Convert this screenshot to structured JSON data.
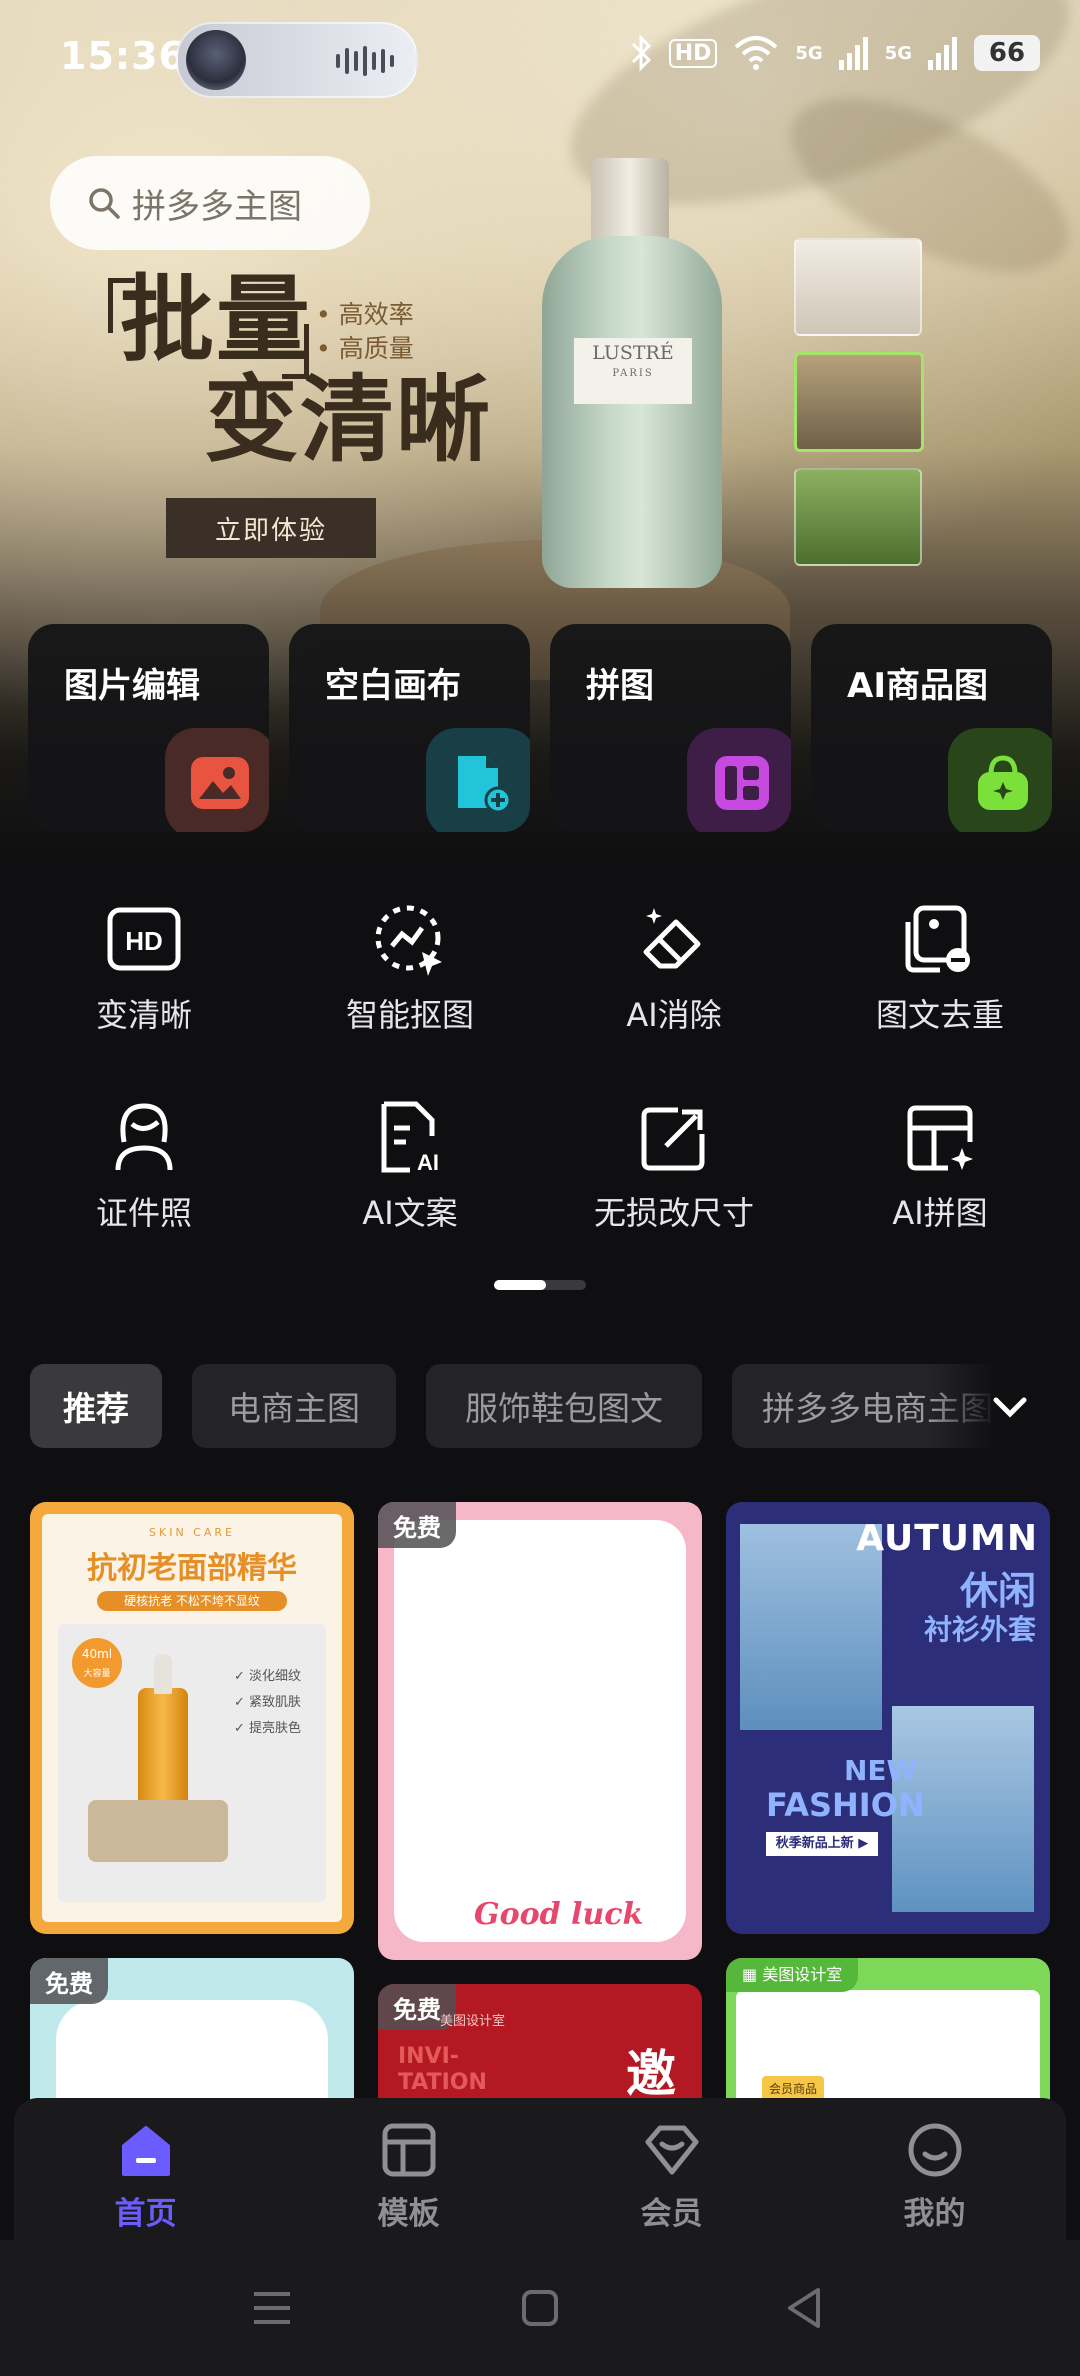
{
  "status_bar": {
    "time": "15:36",
    "hd": "HD",
    "signal1": "5G",
    "signal2": "5G",
    "battery": "66"
  },
  "search": {
    "placeholder": "拼多多主图"
  },
  "banner": {
    "title_line1": "批量",
    "title_line2": "变清晰",
    "point1": "高效率",
    "point2": "高质量",
    "cta": "立即体验",
    "bottle_brand": "LUSTRÉ",
    "bottle_sub": "PARIS"
  },
  "features": [
    {
      "label": "图片编辑",
      "icon": "image-edit-icon",
      "color": "#e8543f"
    },
    {
      "label": "空白画布",
      "icon": "canvas-add-icon",
      "color": "#22c4d9"
    },
    {
      "label": "拼图",
      "icon": "collage-icon",
      "color": "#c64ae0"
    },
    {
      "label": "AI商品图",
      "icon": "shopping-bag-icon",
      "color": "#7be03a"
    }
  ],
  "tools": [
    {
      "label": "变清晰",
      "icon": "hd-icon"
    },
    {
      "label": "智能抠图",
      "icon": "smart-cutout-icon"
    },
    {
      "label": "AI消除",
      "icon": "eraser-icon"
    },
    {
      "label": "图文去重",
      "icon": "dedupe-icon"
    },
    {
      "label": "证件照",
      "icon": "id-photo-icon"
    },
    {
      "label": "AI文案",
      "icon": "ai-copy-icon"
    },
    {
      "label": "无损改尺寸",
      "icon": "resize-icon"
    },
    {
      "label": "AI拼图",
      "icon": "ai-collage-icon"
    }
  ],
  "categories": [
    "推荐",
    "电商主图",
    "服饰鞋包图文",
    "拼多多电商主图"
  ],
  "templates": {
    "card1": {
      "top": "SKIN CARE",
      "title": "抗初老面部精华",
      "subtitle": "硬核抗老 不松不垮不显纹",
      "badge_line1": "40ml",
      "badge_line2": "大容量",
      "features": [
        "淡化细纹",
        "紧致肌肤",
        "提亮肤色"
      ]
    },
    "card2": {
      "tag": "免费",
      "caption": "Good luck"
    },
    "card3": {
      "title_en": "AUTUMN",
      "title_cn1": "休闲",
      "title_cn2": "衬衫外套",
      "sub_en1": "NEW",
      "sub_en2": "FASHION",
      "button": "秋季新品上新 ▶"
    },
    "card4": {
      "tag": "免费"
    },
    "card5": {
      "tag": "免费",
      "studio": "美图设计室",
      "title_en1": "INVI-",
      "title_en2": "TATION",
      "title_cn": "邀"
    },
    "card6": {
      "studio": "美图设计室",
      "badge": "会员商品"
    }
  },
  "nav": [
    {
      "label": "首页",
      "icon": "home-icon",
      "active": true
    },
    {
      "label": "模板",
      "icon": "template-icon",
      "active": false
    },
    {
      "label": "会员",
      "icon": "vip-icon",
      "active": false
    },
    {
      "label": "我的",
      "icon": "profile-icon",
      "active": false
    }
  ],
  "colors": {
    "accent": "#6a5cff",
    "background": "#0f0f11"
  }
}
